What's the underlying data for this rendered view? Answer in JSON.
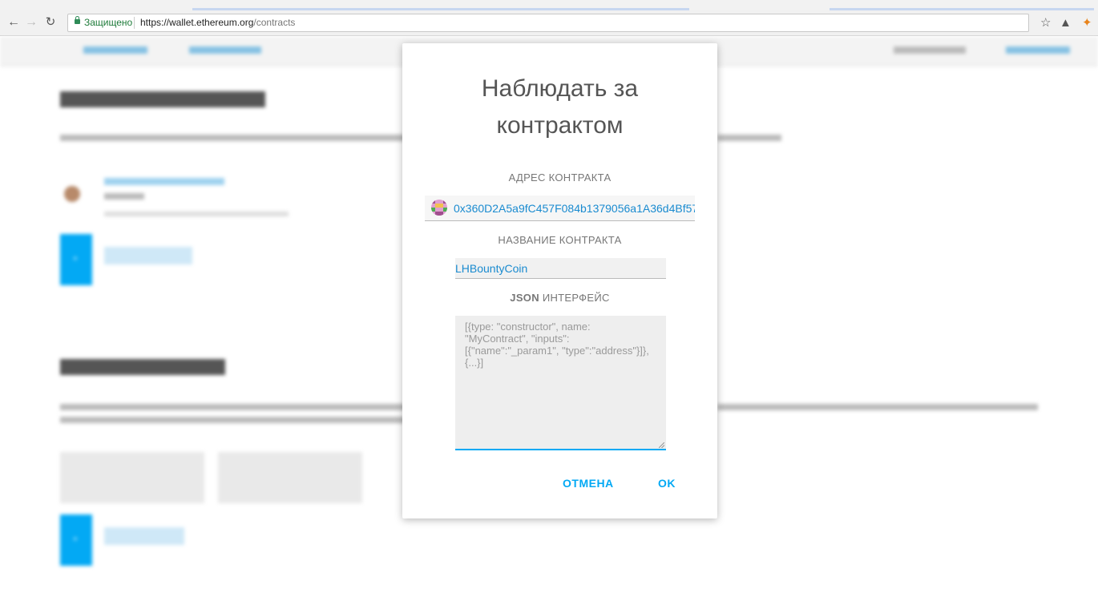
{
  "browser": {
    "secure_label": "Защищено",
    "url_host": "https://wallet.ethereum.org",
    "url_path": "/contracts"
  },
  "modal": {
    "title": "Наблюдать за контрактом",
    "address_label": "АДРЕС КОНТРАКТА",
    "address_value": "0x360D2A5a9fC457F084b1379056a1A36d4Bf57",
    "name_label": "НАЗВАНИЕ КОНТРАКТА",
    "name_value": "LHBountyCoin",
    "json_label_bold": "JSON",
    "json_label_rest": " ИНТЕРФЕЙС",
    "json_placeholder": "[{type: \"constructor\", name: \"MyContract\", \"inputs\": [{\"name\":\"_param1\", \"type\":\"address\"}]}, {...}]",
    "cancel_label": "ОТМЕНА",
    "ok_label": "OK"
  },
  "colors": {
    "accent": "#03a9f4",
    "link": "#1a8bd0"
  }
}
